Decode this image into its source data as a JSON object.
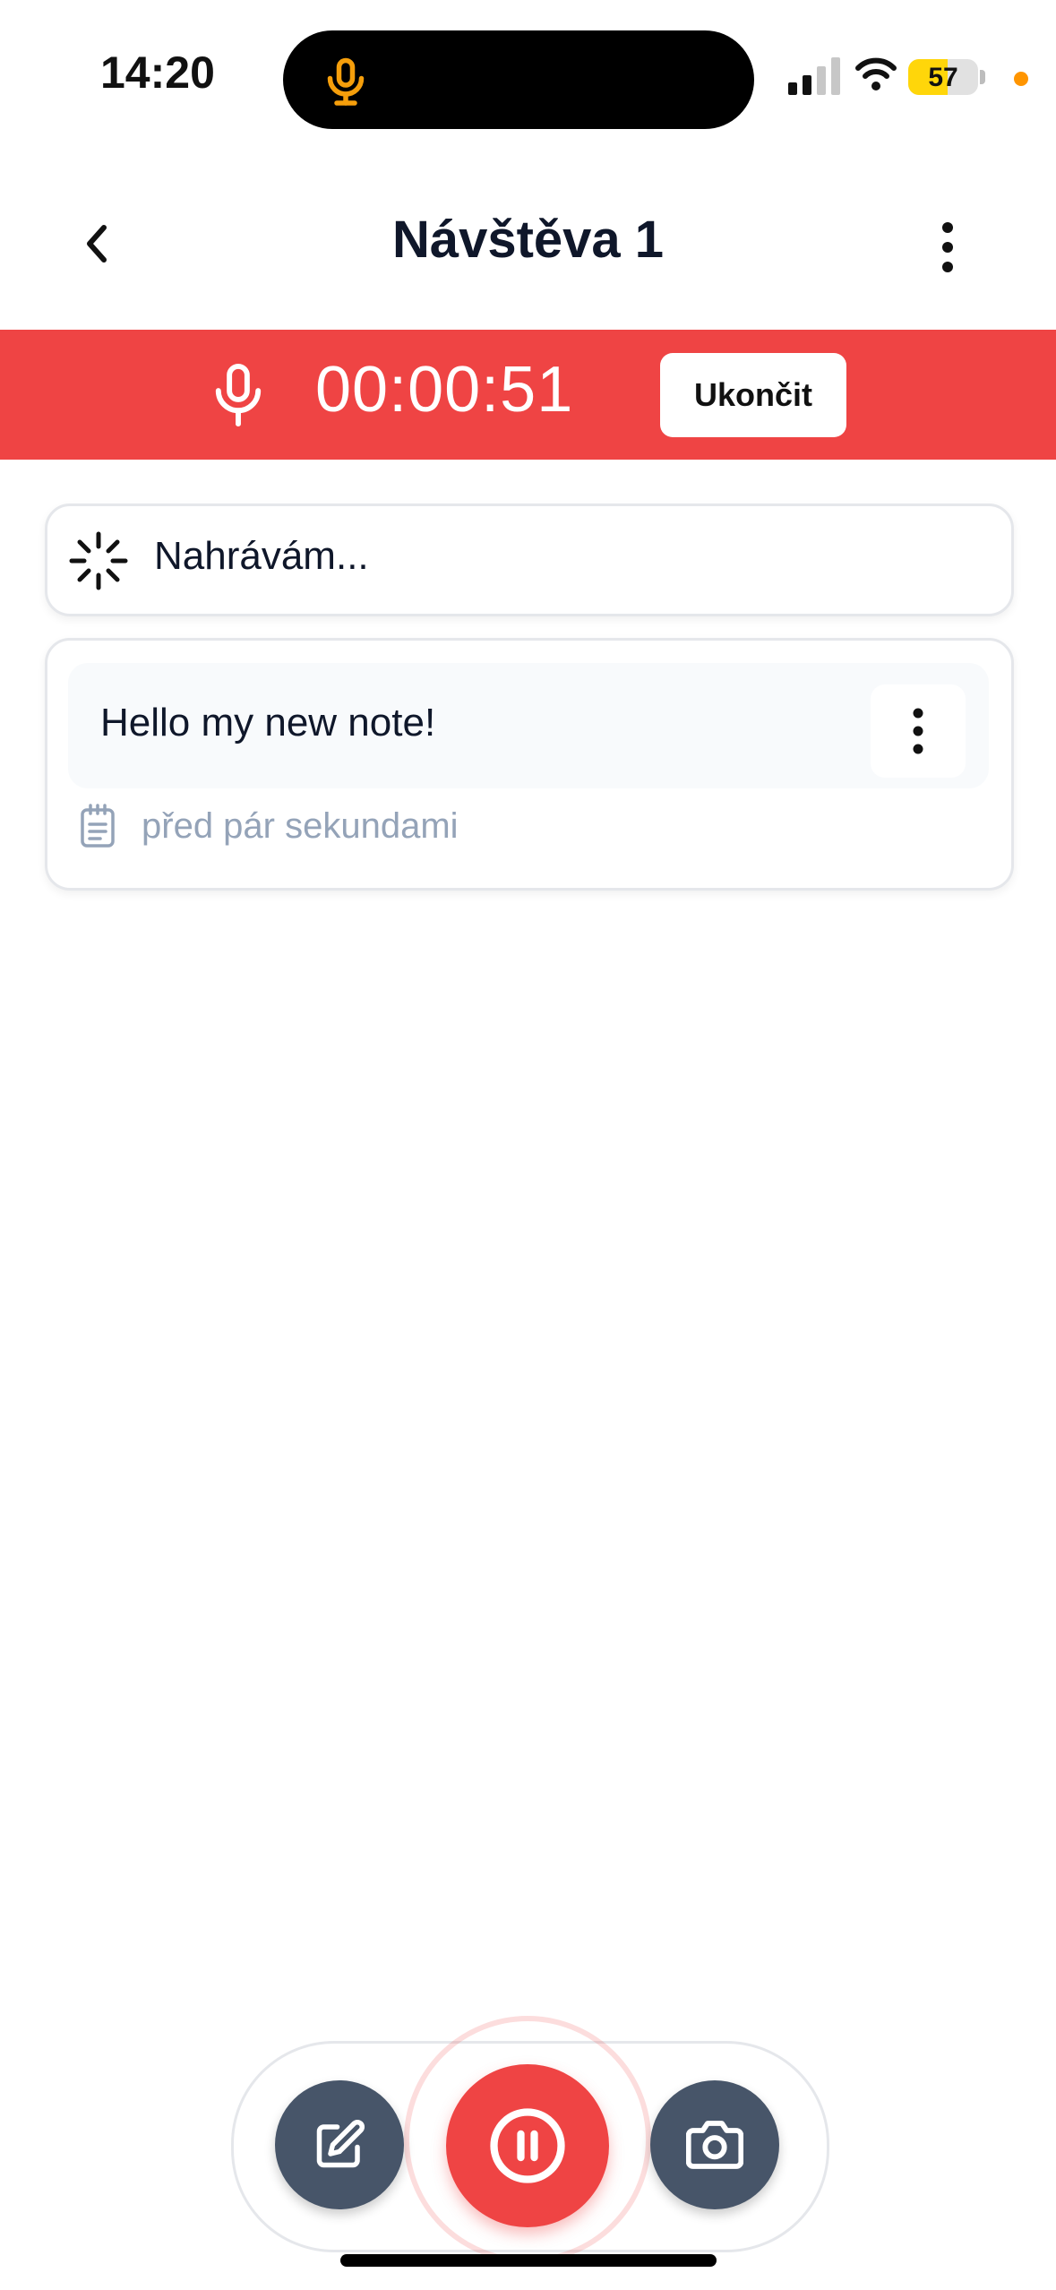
{
  "status_bar": {
    "time": "14:20",
    "battery": "57"
  },
  "header": {
    "title": "Návštěva 1"
  },
  "recording_banner": {
    "timer": "00:00:51",
    "end_label": "Ukončit",
    "color": "#ef4444"
  },
  "recording_status": {
    "label": "Nahrávám..."
  },
  "notes": [
    {
      "text": "Hello my new note!",
      "timestamp": "před pár sekundami"
    }
  ],
  "bottom_bar": {
    "icons": [
      "edit-icon",
      "pause-icon",
      "camera-icon"
    ],
    "accent": "#475569"
  }
}
